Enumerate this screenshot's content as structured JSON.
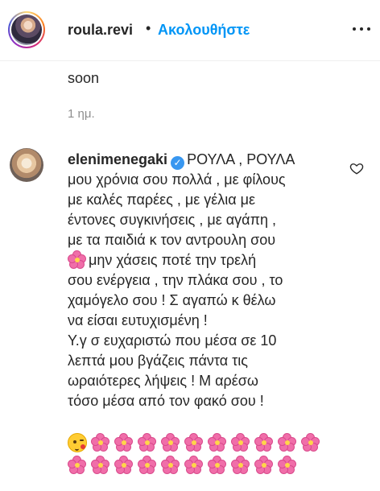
{
  "header": {
    "username": "roula.revi",
    "separator": "•",
    "follow_label": "Ακολουθήστε"
  },
  "previous_comment": {
    "text_tail": "soon",
    "time": "1 ημ."
  },
  "comment": {
    "username": "elenimenegaki",
    "verified_glyph": "✓",
    "lines": [
      "ΡΟΥΛΑ , ΡΟΥΛΑ",
      "μου χρόνια σου πολλά , με φίλους",
      "με καλές παρέες , με γέλια με",
      "έντονες συγκινήσεις , με αγάπη ,",
      "με τα παιδιά κ τον αντρουλη σου",
      "μην χάσεις ποτέ την τρελή",
      "σου ενέργεια , την πλάκα σου , το",
      "χαμόγελο σου ! Σ αγαπώ κ θέλω",
      "να είσαι ευτυχισμένη !",
      "Υ.γ σ ευχαριστώ που μέσα σε 10",
      "λεπτά μου βγάζεις πάντα τις",
      "ωραιότερες λήψεις ! Μ αρέσω",
      "τόσο μέσα από τον φακό σου !"
    ],
    "inline_emoji": "hibiscus-icon",
    "emoji_row_1": [
      "kissing-face-icon",
      "hibiscus-icon",
      "hibiscus-icon",
      "hibiscus-icon",
      "hibiscus-icon",
      "hibiscus-icon",
      "hibiscus-icon",
      "hibiscus-icon",
      "hibiscus-icon",
      "hibiscus-icon",
      "hibiscus-icon"
    ],
    "emoji_row_2": [
      "hibiscus-icon",
      "hibiscus-icon",
      "hibiscus-icon",
      "hibiscus-icon",
      "hibiscus-icon",
      "hibiscus-icon",
      "hibiscus-icon",
      "hibiscus-icon",
      "hibiscus-icon",
      "hibiscus-icon"
    ]
  },
  "colors": {
    "accent": "#0095f6",
    "verified": "#3897f0",
    "text": "#262626",
    "muted": "#8e8e8e"
  }
}
